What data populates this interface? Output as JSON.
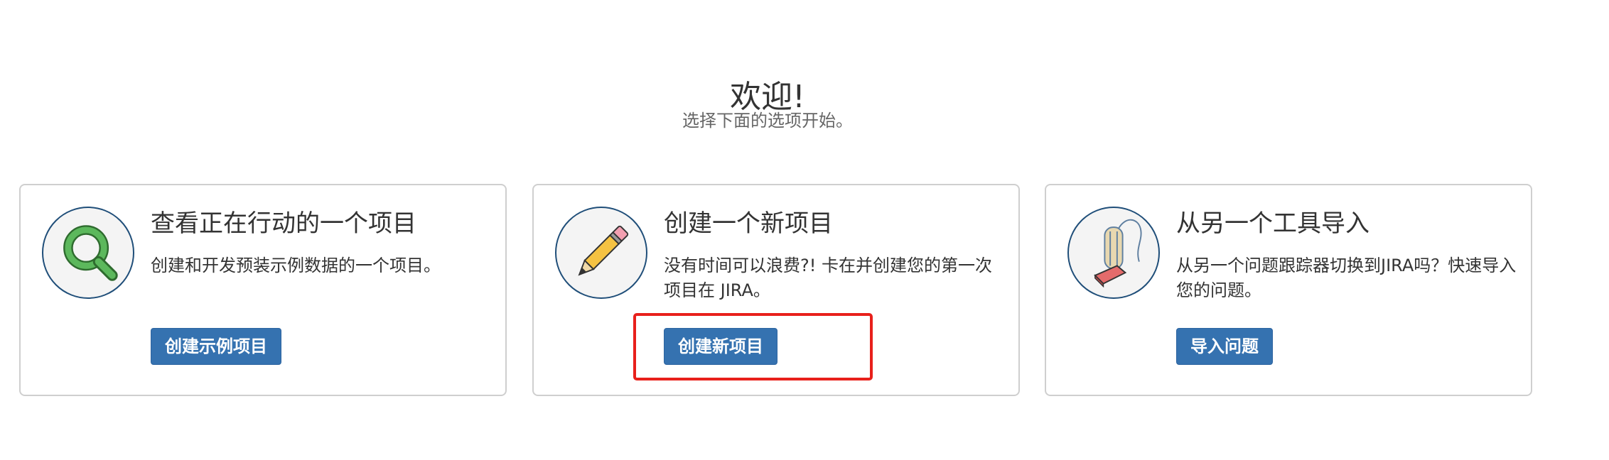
{
  "header": {
    "title": "欢迎!",
    "subtitle": "选择下面的选项开始。"
  },
  "cards": [
    {
      "title": "查看正在行动的一个项目",
      "description": "创建和开发预装示例数据的一个项目。",
      "button_label": "创建示例项目",
      "icon": "magnifier-icon"
    },
    {
      "title": "创建一个新项目",
      "description": "没有时间可以浪费?! 卡在并创建您的第一次项目在 JIRA。",
      "button_label": "创建新项目",
      "icon": "pencil-icon"
    },
    {
      "title": "从另一个工具导入",
      "description": "从另一个问题跟踪器切换到JIRA吗？快速导入您的问题。",
      "button_label": "导入问题",
      "icon": "vacuum-cleaner-icon"
    }
  ],
  "colors": {
    "button_bg": "#3572b0",
    "highlight": "#e8201b",
    "icon_border": "#1f4e79"
  }
}
